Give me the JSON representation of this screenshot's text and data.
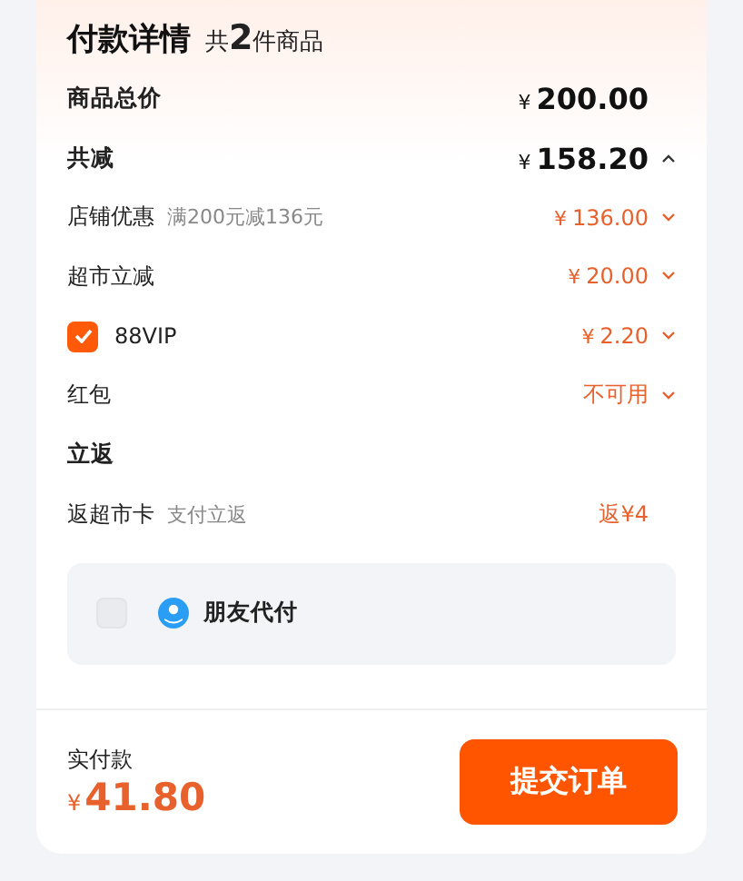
{
  "header": {
    "title": "付款详情",
    "count_prefix": "共",
    "count": "2",
    "count_suffix": "件商品"
  },
  "rows": [
    {
      "kind": "heading",
      "label": "商品总价",
      "currency": "¥",
      "amount": "200.00"
    },
    {
      "kind": "heading",
      "label": "共减",
      "currency": "¥",
      "amount": "158.20",
      "expanded": true
    },
    {
      "kind": "item",
      "label": "店铺优惠",
      "note": "满200元减136元",
      "currency": "¥",
      "amount": "136.00",
      "expanded": false
    },
    {
      "kind": "item",
      "label": "超市立减",
      "currency": "¥",
      "amount": "20.00",
      "expanded": false
    },
    {
      "kind": "check",
      "label": "88VIP",
      "checked": true,
      "currency": "¥",
      "amount": "2.20",
      "expanded": false
    },
    {
      "kind": "item",
      "label": "红包",
      "value": "不可用",
      "expanded": false
    },
    {
      "kind": "section",
      "label": "立返"
    },
    {
      "kind": "item",
      "label": "返超市卡",
      "note": "支付立返",
      "value": "返¥4"
    }
  ],
  "friend_pay": {
    "label": "朋友代付",
    "checked": false
  },
  "footer": {
    "label": "实付款",
    "currency": "¥",
    "amount": "41.80",
    "button": "提交订单"
  }
}
